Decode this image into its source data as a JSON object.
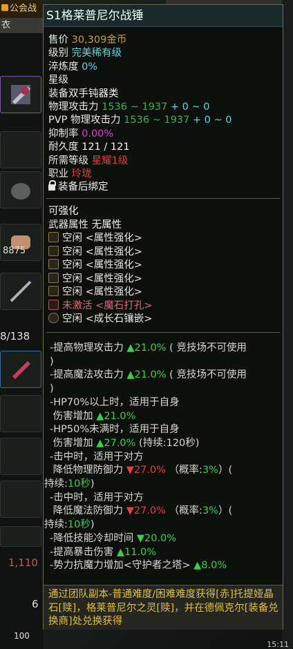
{
  "left_panel": {
    "guild_label": "公会战",
    "tab_label": "衣",
    "count_a": "8875",
    "count_b": "8/138",
    "count_c": "1,110",
    "count_d": "6",
    "count_e": "100"
  },
  "clock": "15:11",
  "tooltip": {
    "title": "S1格莱普尼尔战锤",
    "price_label": "售价",
    "price_value": "30,309金币",
    "grade_label": "级别",
    "grade_value": "完美稀有级",
    "refine_label": "淬炼度",
    "refine_value": "0%",
    "star_label": "星级",
    "equip_label": "装备",
    "equip_value": "双手钝器类",
    "phys_label": "物理攻击力",
    "phys_value": "1536 ~ 1937",
    "phys_bonus": "+ 0 ~ 0",
    "pvp_label": "PVP 物理攻击力",
    "pvp_value": "1536 ~ 1937",
    "pvp_bonus": "+ 0 ~ 0",
    "suppress_label": "抑制率",
    "suppress_value": "0.00%",
    "durability_label": "耐久度",
    "durability_value": "121 / 121",
    "level_label": "所需等级",
    "level_value": "星耀1级",
    "job_label": "职业",
    "job_value": "玲珑",
    "bind_text": "装备后绑定",
    "enhance_label": "可强化",
    "weapon_attr_label": "武器属性",
    "weapon_attr_value": "无属性",
    "sockets": [
      "空闲 <属性强化>",
      "空闲 <属性强化>",
      "空闲 <属性强化>",
      "空闲 <属性强化>",
      "空闲 <属性强化>"
    ],
    "inactive_socket": "未激活 <魔石打孔>",
    "growth_socket": "空闲 <成长石镶嵌>",
    "effects": {
      "e1a": "-提高物理攻击力",
      "e1b": "▲21.0%",
      "e1c": "( 竞技场不可使用",
      "e1d": ")",
      "e2a": "-提高魔法攻击力",
      "e2b": "▲21.0%",
      "e2c": "( 竞技场不可使用",
      "e2d": ")",
      "e3a": "-HP70%以上时，适用于自身",
      "e3b": "伤害增加",
      "e3c": "▲21.0%",
      "e4a": "-HP50%未满时，适用于自身",
      "e4b": "伤害增加",
      "e4c": "▲27.0%",
      "e4d": "(持续:120秒)",
      "e5a": "-击中时，适用于对方",
      "e5b": "降低物理防御力",
      "e5c": "▼27.0%",
      "e5d": "（概率:",
      "e5e": "3%",
      "e5f": "）(",
      "e5g": "持续:",
      "e5h": "10秒",
      "e5i": ")",
      "e6a": "-击中时，适用于对方",
      "e6b": "降低魔法防御力",
      "e6c": "▼27.0%",
      "e6d": "（概率:",
      "e6e": "3%",
      "e6f": "）(",
      "e6g": "持续:",
      "e6h": "10秒",
      "e6i": ")",
      "e7a": "-降低技能冷却时间",
      "e7b": "▼20.0%",
      "e8a": "-提高暴击伤害",
      "e8b": "▲11.0%",
      "e9a": "-势力抗魔力增加<守护者之塔>",
      "e9b": "▲8.0%"
    },
    "source_text": "通过团队副本-普通难度/困难难度获得[赤]托提娅晶石[赎]，格莱普尼尔之灵[赎]，并在德佩克尔[装备兑换商]处兑换获得"
  }
}
